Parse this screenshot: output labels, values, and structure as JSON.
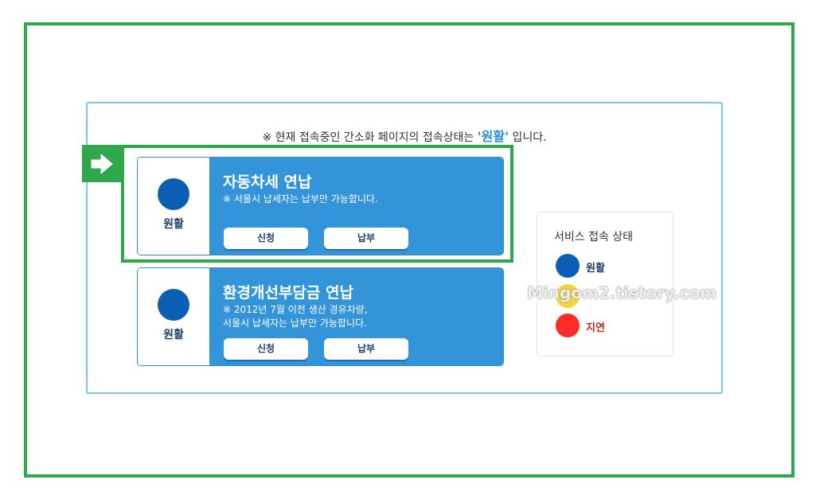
{
  "status": {
    "prefix": "※ 현재 접속중인 간소화 페이지의 접속상태는 ",
    "state": "'원활'",
    "suffix": " 입니다."
  },
  "cards": [
    {
      "state": "원활",
      "title": "자동차세 연납",
      "desc_lines": [
        "※ 서울시 납세자는 납부만 가능합니다."
      ],
      "apply_label": "신청",
      "pay_label": "납부"
    },
    {
      "state": "원활",
      "title": "환경개선부담금 연납",
      "desc_lines": [
        "※ 2012년 7월 이전 생산 경유차량,",
        "서울시 납세자는 납부만 가능합니다."
      ],
      "apply_label": "신청",
      "pay_label": "납부"
    }
  ],
  "legend": {
    "title": "서비스 접속 상태",
    "items": [
      {
        "label": "원활",
        "color": "#0a5fb4"
      },
      {
        "label": "",
        "color": "#f5d33a"
      },
      {
        "label": "지연",
        "color": "#ff2b2b"
      }
    ]
  },
  "watermark": "Mingom2.tistory.com",
  "colors": {
    "frame_green": "#2ea84a",
    "card_blue": "#3394d9",
    "state_dot_blue": "#0a5fb4",
    "panel_border": "#78c6ec"
  },
  "icons": {
    "marker": "arrow-right-icon"
  }
}
